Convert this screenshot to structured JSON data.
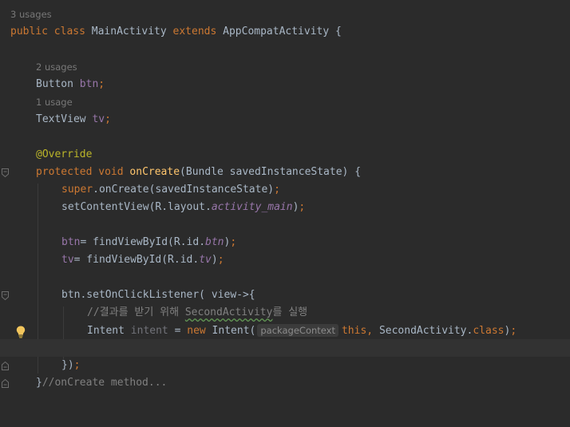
{
  "editor": {
    "lines": [
      {
        "usage_hint": "3 usages"
      },
      {
        "public": "public",
        "class": "class",
        "name": "MainActivity",
        "extends": "extends",
        "parent": "AppCompatActivity",
        "brace": "{"
      },
      {
        "usage_hint": "2 usages"
      },
      {
        "type": "Button",
        "name": "btn",
        "semi": ";"
      },
      {
        "usage_hint": "1 usage"
      },
      {
        "type": "TextView",
        "name": "tv",
        "semi": ";"
      },
      {
        "annotation": "@Override"
      },
      {
        "protected": "protected",
        "void": "void",
        "method": "onCreate",
        "params": "(Bundle savedInstanceState) {"
      },
      {
        "super": "super",
        "call": ".onCreate(savedInstanceState)",
        "semi": ";"
      },
      {
        "call": "setContentView(R.layout.",
        "field": "activity_main",
        "close": ")",
        "semi": ";"
      },
      {
        "var": "btn",
        "assign": "= findViewById(R.id.",
        "field": "btn",
        "close": ")",
        "semi": ";"
      },
      {
        "var": "tv",
        "assign": "= findViewById(R.id.",
        "field": "tv",
        "close": ")",
        "semi": ";"
      },
      {
        "call": "btn.setOnClickListener( view->{"
      },
      {
        "comment_prefix": "//결과를 받기 위해 ",
        "comment_word": "SecondActivity",
        "comment_suffix": "를 실행"
      },
      {
        "type": "Intent",
        "var": "intent",
        "eq": " = ",
        "new": "new",
        "ctor": " Intent(",
        "param_hint": "packageContext",
        "this": "this",
        "comma": ", ",
        "arg": "SecondActivity.",
        "class": "class",
        "close": ")",
        "semi": ";"
      },
      {
        "close": "})",
        "semi": ";"
      },
      {
        "close": "}",
        "comment": "//onCreate method..."
      }
    ]
  }
}
